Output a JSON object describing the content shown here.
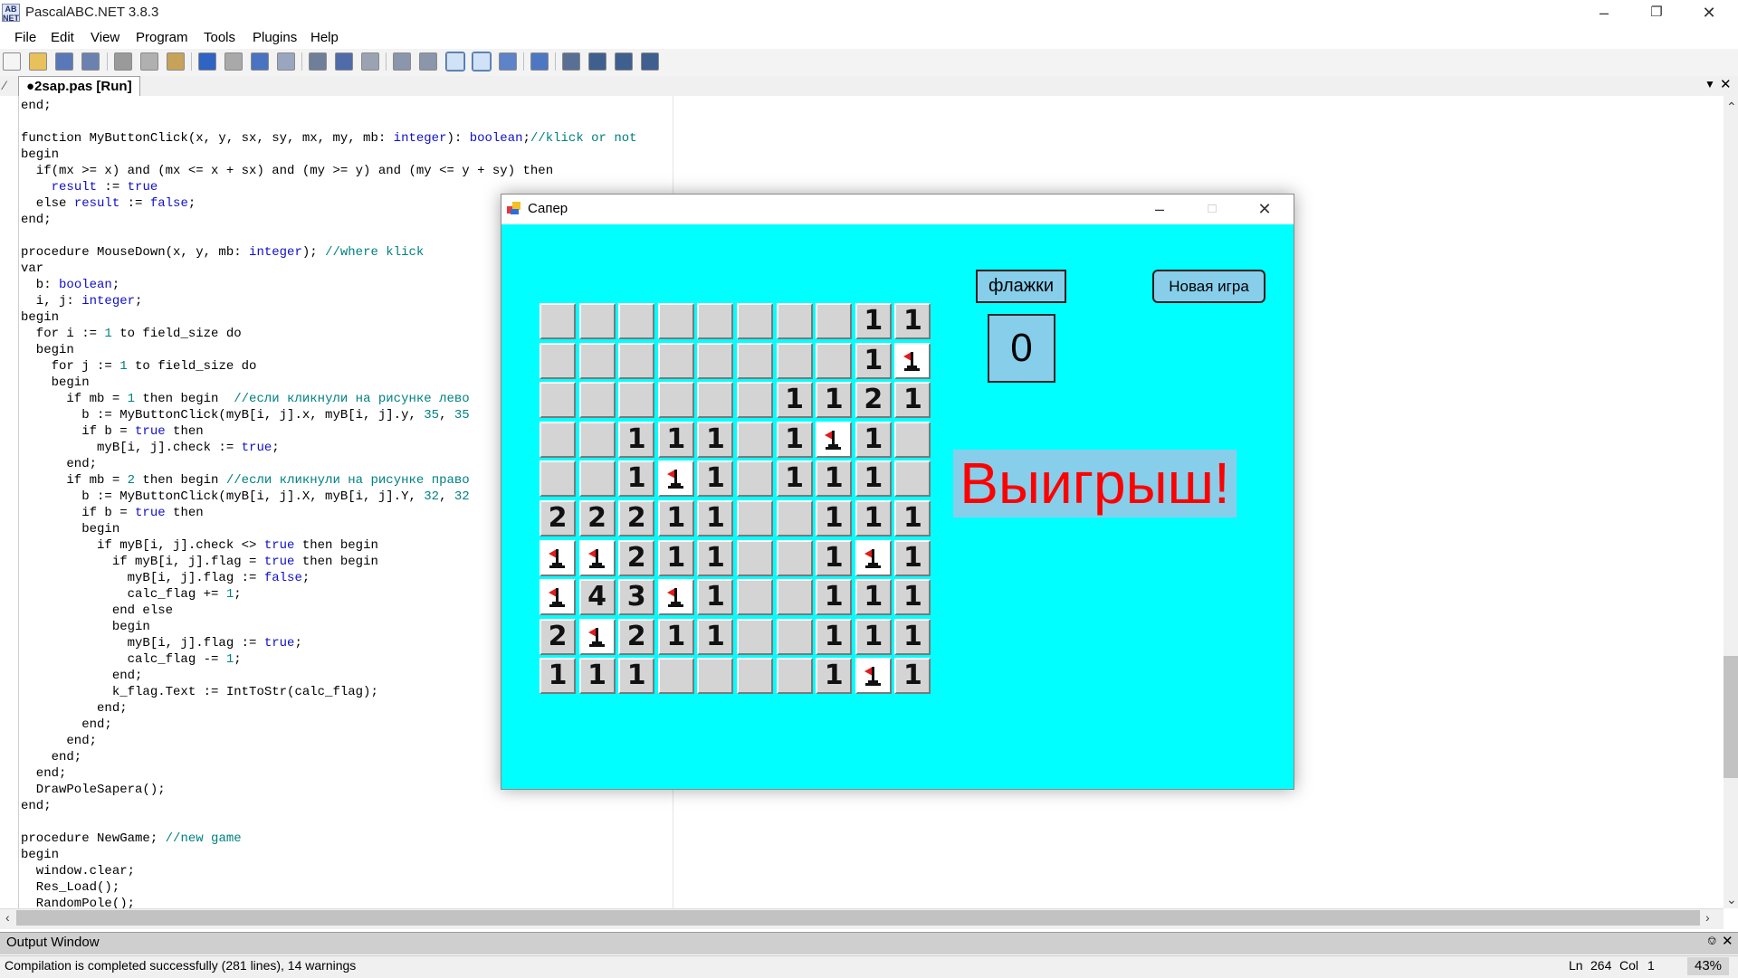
{
  "window": {
    "title": "PascalABC.NET 3.8.3"
  },
  "menu": [
    "File",
    "Edit",
    "View",
    "Program",
    "Tools",
    "Plugins",
    "Help"
  ],
  "toolbar_icons": [
    "new-icon",
    "open-icon",
    "save-icon",
    "save-all-icon",
    "cut-icon",
    "copy-icon",
    "paste-icon",
    "undo-icon",
    "redo-icon",
    "find-icon",
    "replace-icon",
    "run-icon",
    "stop-icon",
    "debug-icon",
    "step-icon",
    "step-over-icon",
    "output-icon",
    "format-icon",
    "indent-icon",
    "compile-icon",
    "form-icon",
    "tool-a-icon",
    "tool-b-icon",
    "tool-c-icon"
  ],
  "tab": {
    "label": "●2sap.pas [Run]"
  },
  "code_lines": [
    "end;",
    "",
    "function MyButtonClick(x, y, sx, sy, mx, my, mb: integer): boolean;//klick or not",
    "begin",
    "  if(mx >= x) and (mx <= x + sx) and (my >= y) and (my <= y + sy) then",
    "    result := true",
    "  else result := false;",
    "end;",
    "",
    "procedure MouseDown(x, y, mb: integer); //where klick",
    "var",
    "  b: boolean;",
    "  i, j: integer;",
    "begin",
    "  for i := 1 to field_size do",
    "  begin",
    "    for j := 1 to field_size do",
    "    begin",
    "      if mb = 1 then begin  //если кликнули на рисунке лево",
    "        b := MyButtonClick(myB[i, j].x, myB[i, j].y, 35, 35",
    "        if b = true then",
    "          myB[i, j].check := true;",
    "      end;",
    "      if mb = 2 then begin //если кликнули на рисунке право",
    "        b := MyButtonClick(myB[i, j].X, myB[i, j].Y, 32, 32",
    "        if b = true then",
    "        begin",
    "          if myB[i, j].check <> true then begin",
    "            if myB[i, j].flag = true then begin",
    "              myB[i, j].flag := false;",
    "              calc_flag += 1;",
    "            end else",
    "            begin",
    "              myB[i, j].flag := true;",
    "              calc_flag -= 1;",
    "            end;",
    "            k_flag.Text := IntToStr(calc_flag);",
    "          end;",
    "        end;",
    "      end;",
    "    end;",
    "  end;",
    "  DrawPoleSapera();",
    "end;",
    "",
    "procedure NewGame; //new game",
    "begin",
    "  window.clear;",
    "  Res_Load();",
    "  RandomPole();"
  ],
  "output": {
    "title": "Output Window"
  },
  "status": {
    "message": "Compilation is completed successfully (281 lines), 14 warnings",
    "ln_label": "Ln",
    "ln": "264",
    "col_label": "Col",
    "col": "1",
    "zoom": "43%"
  },
  "game": {
    "title": "Сапер",
    "flags_label": "флажки",
    "new_game_label": "Новая игра",
    "flag_count": "0",
    "win_text": "Выигрыш!",
    "board": [
      [
        " ",
        " ",
        " ",
        " ",
        " ",
        " ",
        " ",
        " ",
        "1",
        "1"
      ],
      [
        " ",
        " ",
        " ",
        " ",
        " ",
        " ",
        " ",
        " ",
        "1",
        "F"
      ],
      [
        " ",
        " ",
        " ",
        " ",
        " ",
        " ",
        "1",
        "1",
        "2",
        "1"
      ],
      [
        " ",
        " ",
        "1",
        "1",
        "1",
        " ",
        "1",
        "F",
        "1",
        " "
      ],
      [
        " ",
        " ",
        "1",
        "F",
        "1",
        " ",
        "1",
        "1",
        "1",
        " "
      ],
      [
        "2",
        "2",
        "2",
        "1",
        "1",
        " ",
        " ",
        "1",
        "1",
        "1"
      ],
      [
        "F",
        "F",
        "2",
        "1",
        "1",
        " ",
        " ",
        "1",
        "F",
        "1"
      ],
      [
        "F",
        "4",
        "3",
        "F",
        "1",
        " ",
        " ",
        "1",
        "1",
        "1"
      ],
      [
        "2",
        "F",
        "2",
        "1",
        "1",
        " ",
        " ",
        "1",
        "1",
        "1"
      ],
      [
        "1",
        "1",
        "1",
        " ",
        " ",
        " ",
        " ",
        "1",
        "F",
        "1"
      ]
    ]
  }
}
